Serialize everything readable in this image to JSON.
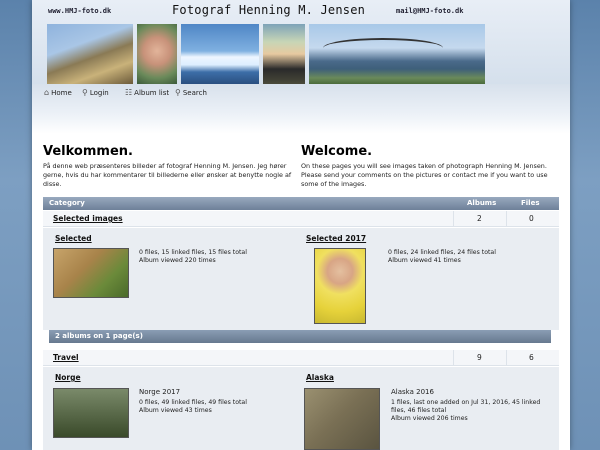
{
  "header": {
    "site_url": "www.HMJ-foto.dk",
    "title": "Fotograf Henning M. Jensen",
    "email": "mail@HMJ-foto.dk"
  },
  "nav": {
    "items": [
      {
        "label": "Home",
        "icon": "home-icon"
      },
      {
        "label": "Login",
        "icon": "login-icon"
      },
      {
        "label": "Album list",
        "icon": "album-list-icon"
      },
      {
        "label": "Search",
        "icon": "search-icon"
      }
    ]
  },
  "welcome": {
    "da_title": "Velkommen.",
    "da_text": "På denne web præsenteres billeder af fotograf Henning M. Jensen. Jeg hører gerne, hvis du har kommentarer til billederne eller ønsker at benytte nogle af disse.",
    "en_title": "Welcome.",
    "en_text": "On these pages you will see images taken of photograph Henning M. Jensen. Please send your comments on the pictures or contact me if you want to use some of the images."
  },
  "table": {
    "headers": {
      "category": "Category",
      "albums": "Albums",
      "files": "Files"
    },
    "rows": [
      {
        "name": "Selected images",
        "albums": "2",
        "files": "0"
      },
      {
        "name": "Travel",
        "albums": "9",
        "files": "6"
      }
    ]
  },
  "selected_albums": [
    {
      "title": "Selected",
      "line1": "0 files, 15 linked files, 15 files total",
      "line2": "Album viewed 220 times"
    },
    {
      "title": "Selected 2017",
      "line1": "0 files, 24 linked files, 24 files total",
      "line2": "Album viewed 41 times"
    }
  ],
  "pager_text": "2 albums on 1 page(s)",
  "travel_albums": [
    {
      "title": "Norge",
      "subtitle": "Norge 2017",
      "line1": "0 files, 49 linked files, 49 files total",
      "line2": "Album viewed 43 times"
    },
    {
      "title": "Alaska",
      "subtitle": "Alaska 2016",
      "line1": "1 files, last one added on Jul 31, 2016, 45 linked",
      "line2": "files, 46 files total",
      "line3": "Album viewed 206 times"
    }
  ]
}
